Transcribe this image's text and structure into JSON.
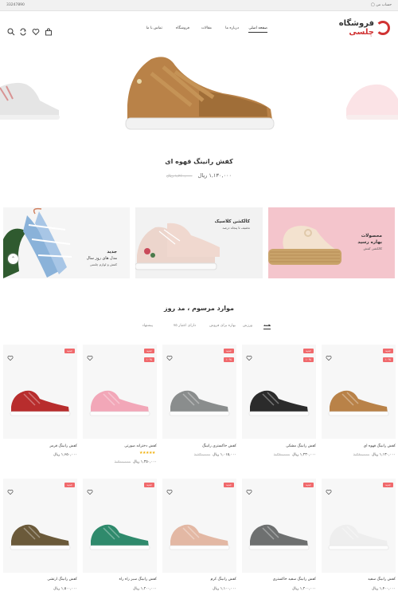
{
  "topbar": {
    "phone": "33247890",
    "account": "حساب من"
  },
  "logo": {
    "line1": "فروشگاه",
    "line2": "چلسی"
  },
  "nav": {
    "items": [
      "صفحه اصلی",
      "درباره ما",
      "مقالات",
      "فروشگاه",
      "تماس با ما"
    ]
  },
  "header_icons": [
    "search-icon",
    "refresh-icon",
    "heart-icon",
    "bag-icon"
  ],
  "hero": {
    "title": "کفش رانینگ قهوه ای",
    "price": "۱,۱۳۰,۰۰۰ ریال",
    "old_price": "۱,۲۶۰,۰۰۰ ریال"
  },
  "banners": [
    {
      "title": "جدید",
      "line2": "مدل های روز سال",
      "sub": "کفش و لوازم چلسی"
    },
    {
      "title": "کالکشن کلاسیک",
      "line2": "",
      "sub": "تخفیف تا پنجاه درصد"
    },
    {
      "title": "محصولات",
      "line2": "بهاره رسید",
      "sub": "کالکشن کفش"
    }
  ],
  "section_title": "موارد مرسوم ، مد روز",
  "tabs": [
    "همه",
    "ورزش",
    "بهاره برای فروش",
    "دارای اعتبار ۷۵",
    "پیشنهاد"
  ],
  "colors": {
    "accent": "#f0696c",
    "brand": "#d03333",
    "star": "#f1b10f"
  },
  "products_row1": [
    {
      "name": "کفش رانینگ قهوه ای",
      "price": "۱,۱۳۰,۰۰۰ ریال",
      "old": "۱,۲۶۰,۰۰۰",
      "badges": [
        "جدید",
        "۱۰%"
      ],
      "color": "#b98248"
    },
    {
      "name": "کفش رانینگ مشکی",
      "price": "۱,۲۳۰,۰۰۰ ریال",
      "old": "۱,۳۶۰,۰۰۰",
      "badges": [
        "جدید",
        "۱۰%"
      ],
      "color": "#2b2b2b"
    },
    {
      "name": "کفش خاکستری رانینگ",
      "price": "۱,۰۱۵,۰۰۰ ریال",
      "old": "۱,۱۳۰,۰۰۰",
      "badges": [
        "جدید",
        "۱۰%"
      ],
      "color": "#8a8d8d"
    },
    {
      "name": "کفش دخترانه صورتی",
      "price": "۱,۳۵۰,۰۰۰ ریال",
      "old": "۱,۵۰۰,۰۰۰",
      "badges": [
        "جدید",
        "۱۰%"
      ],
      "color": "#f2a7b8",
      "stars": "★★★★★"
    },
    {
      "name": "کفش رانینگ قرمز",
      "price": "۱,۶۵۰,۰۰۰ ریال",
      "old": "",
      "badges": [
        "جدید"
      ],
      "color": "#b82d2d"
    }
  ],
  "products_row2": [
    {
      "name": "کفش رانینگ سفید",
      "price": "۱,۴۰۰,۰۰۰ ریال",
      "old": "",
      "badges": [
        "جدید"
      ],
      "color": "#eeeeee"
    },
    {
      "name": "کفش رانینگ سفید خاکستری",
      "price": "۱,۲۰۰,۰۰۰ ریال",
      "old": "",
      "badges": [
        "جدید"
      ],
      "color": "#6e7070"
    },
    {
      "name": "کفش رانینگ کرم",
      "price": "۱,۱۰۰,۰۰۰ ریال",
      "old": "",
      "badges": [
        "جدید"
      ],
      "color": "#e3b8a4"
    },
    {
      "name": "کفش رانینگ سبز راه راه",
      "price": "۱,۲۰۰,۰۰۰ ریال",
      "old": "",
      "badges": [
        "جدید"
      ],
      "color": "#2f8a6c"
    },
    {
      "name": "کفش رانینگ ارتشی",
      "price": "۱,۵۰۰,۰۰۰ ریال",
      "old": "",
      "badges": [
        "جدید"
      ],
      "color": "#6b5a3a"
    }
  ]
}
